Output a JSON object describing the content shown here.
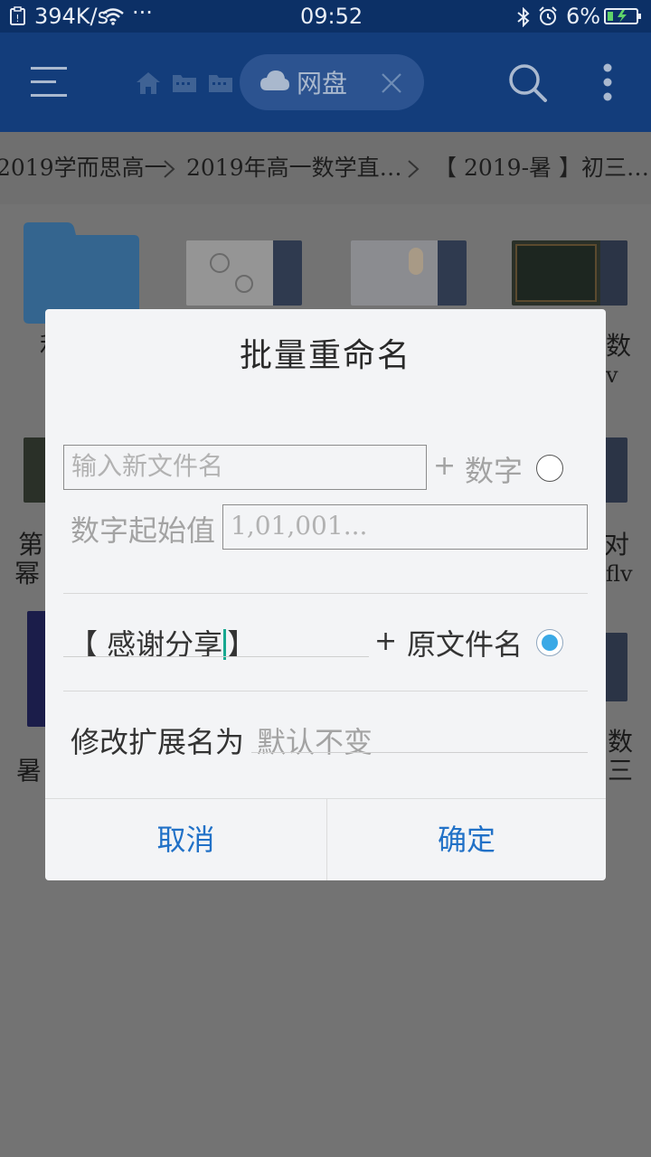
{
  "status_bar": {
    "net_speed": "394K/s",
    "dots": "···",
    "time": "09:52",
    "battery_pct": "6%"
  },
  "toolbar": {
    "tab_label": "网盘",
    "icons": [
      "menu-icon",
      "home-icon",
      "folder-icon",
      "folder-icon",
      "cloud-icon",
      "close-icon",
      "search-icon",
      "more-vertical-icon"
    ]
  },
  "breadcrumb": [
    "2019学而思高一",
    "2019年高一数学直…",
    "【 2019-暑 】初三…"
  ],
  "background_files": {
    "fragments": [
      "利",
      "数",
      "v",
      "第",
      "幂",
      "对",
      "flv",
      "暑",
      "数",
      "三"
    ]
  },
  "dialog": {
    "title": "批量重命名",
    "new_name_placeholder": "输入新文件名",
    "plus1": "+",
    "number_label": "数字",
    "number_start_label": "数字起始值",
    "number_start_placeholder": "1,01,001...",
    "prefix_value_a": "【 感谢分享",
    "prefix_value_b": "】",
    "plus2": "+",
    "original_name_label": "原文件名",
    "extension_label": "修改扩展名为",
    "extension_placeholder": "默认不变",
    "cancel_label": "取消",
    "confirm_label": "确定",
    "selected_option": "original_name"
  },
  "colors": {
    "status_bar": "#0c3066",
    "toolbar": "#133d7b",
    "dialog_bg": "#f3f4f6",
    "button_text": "#2171c7",
    "radio_selected": "#3aa9e6",
    "cursor": "#17a890"
  }
}
